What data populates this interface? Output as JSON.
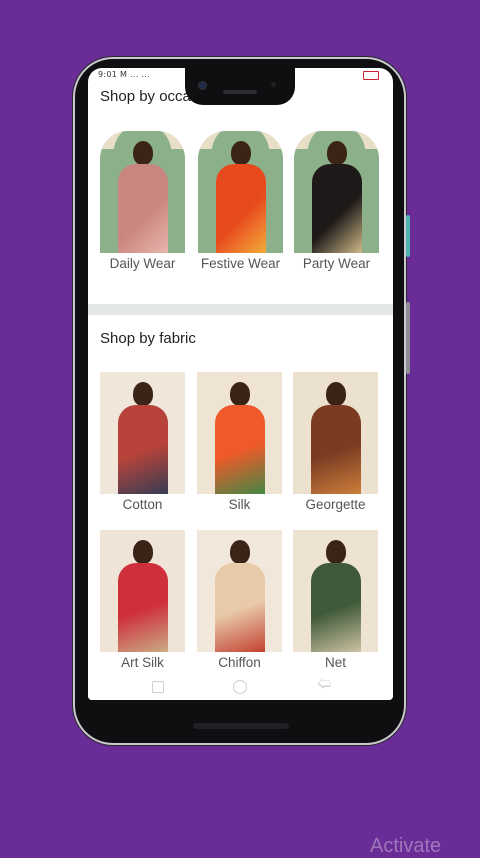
{
  "status_bar": {
    "time_text": "9:01 M ... ..."
  },
  "occasion_section": {
    "title": "Shop by occasion",
    "items": [
      {
        "label": "Daily Wear",
        "colors": [
          "#c9857f",
          "#e9b8ae"
        ]
      },
      {
        "label": "Festive Wear",
        "colors": [
          "#e84a1f",
          "#f3b03a"
        ]
      },
      {
        "label": "Party Wear",
        "colors": [
          "#1e1a1a",
          "#d9c28e"
        ]
      }
    ]
  },
  "fabric_section": {
    "title": "Shop by fabric",
    "items": [
      {
        "label": "Cotton",
        "colors": [
          "#b8433a",
          "#2f3d55"
        ]
      },
      {
        "label": "Silk",
        "colors": [
          "#ee5a2a",
          "#3a8a46"
        ]
      },
      {
        "label": "Georgette",
        "colors": [
          "#7a3b22",
          "#d1823c"
        ]
      },
      {
        "label": "Art Silk",
        "colors": [
          "#cf2e3b",
          "#c9b48a"
        ]
      },
      {
        "label": "Chiffon",
        "colors": [
          "#e8c9a8",
          "#c0392b"
        ]
      },
      {
        "label": "Net",
        "colors": [
          "#3f5a3a",
          "#d5c8a8"
        ]
      }
    ]
  },
  "watermark": {
    "text": "Activate"
  },
  "colors": {
    "background": "#6a2c96",
    "divider": "#e3e6e6"
  }
}
